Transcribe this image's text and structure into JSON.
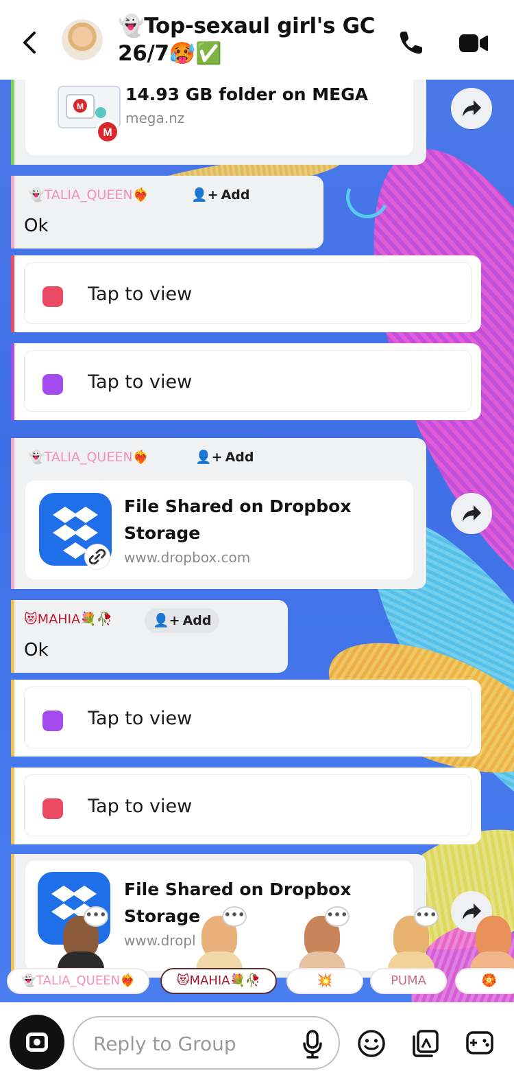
{
  "header": {
    "back_icon": "chevron-left-icon",
    "title": "👻Top-sexaul girl's GC 26/7🥵✅",
    "call_icon": "phone-icon",
    "video_icon": "video-camera-icon"
  },
  "messages": {
    "mega_link": {
      "title": "14.93 GB folder on MEGA",
      "domain": "mega.nz"
    },
    "msg1": {
      "sender": "👻TALIA_QUEEN❤️‍🔥",
      "add_label": "Add",
      "text": "Ok"
    },
    "snap1": {
      "label": "Tap to view",
      "color": "#ea4a63"
    },
    "snap2": {
      "label": "Tap to view",
      "color": "#a44bf0"
    },
    "msg2": {
      "sender": "👻TALIA_QUEEN❤️‍🔥",
      "add_label": "Add",
      "link_title": "File Shared on Dropbox Storage",
      "link_domain": "www.dropbox.com"
    },
    "msg3": {
      "sender": "😻MAHIA💐🥀",
      "add_label": "Add",
      "text": "Ok"
    },
    "snap3": {
      "label": "Tap to view",
      "color": "#a44bf0"
    },
    "snap4": {
      "label": "Tap to view",
      "color": "#ea4a63"
    },
    "msg4": {
      "link_title": "File Shared on Dropbox Storage",
      "link_domain": "www.dropl"
    }
  },
  "typing": {
    "names": [
      "👻TALIA_QUEEN❤️‍🔥",
      "😻MAHIA💐🥀",
      "💥",
      "PUMA",
      "🏵️"
    ]
  },
  "composer": {
    "placeholder": "Reply to Group",
    "camera_icon": "camera-icon",
    "mic_icon": "microphone-icon",
    "emoji_icon": "smiley-icon",
    "sticker_icon": "sticker-icon",
    "game_icon": "game-controller-icon"
  },
  "colors": {
    "snap_red": "#ea4a63",
    "snap_purple": "#a44bf0",
    "talia_name": "#f48fb9",
    "mahia_name": "#b8182d",
    "dropbox_blue": "#1f6fe8"
  }
}
